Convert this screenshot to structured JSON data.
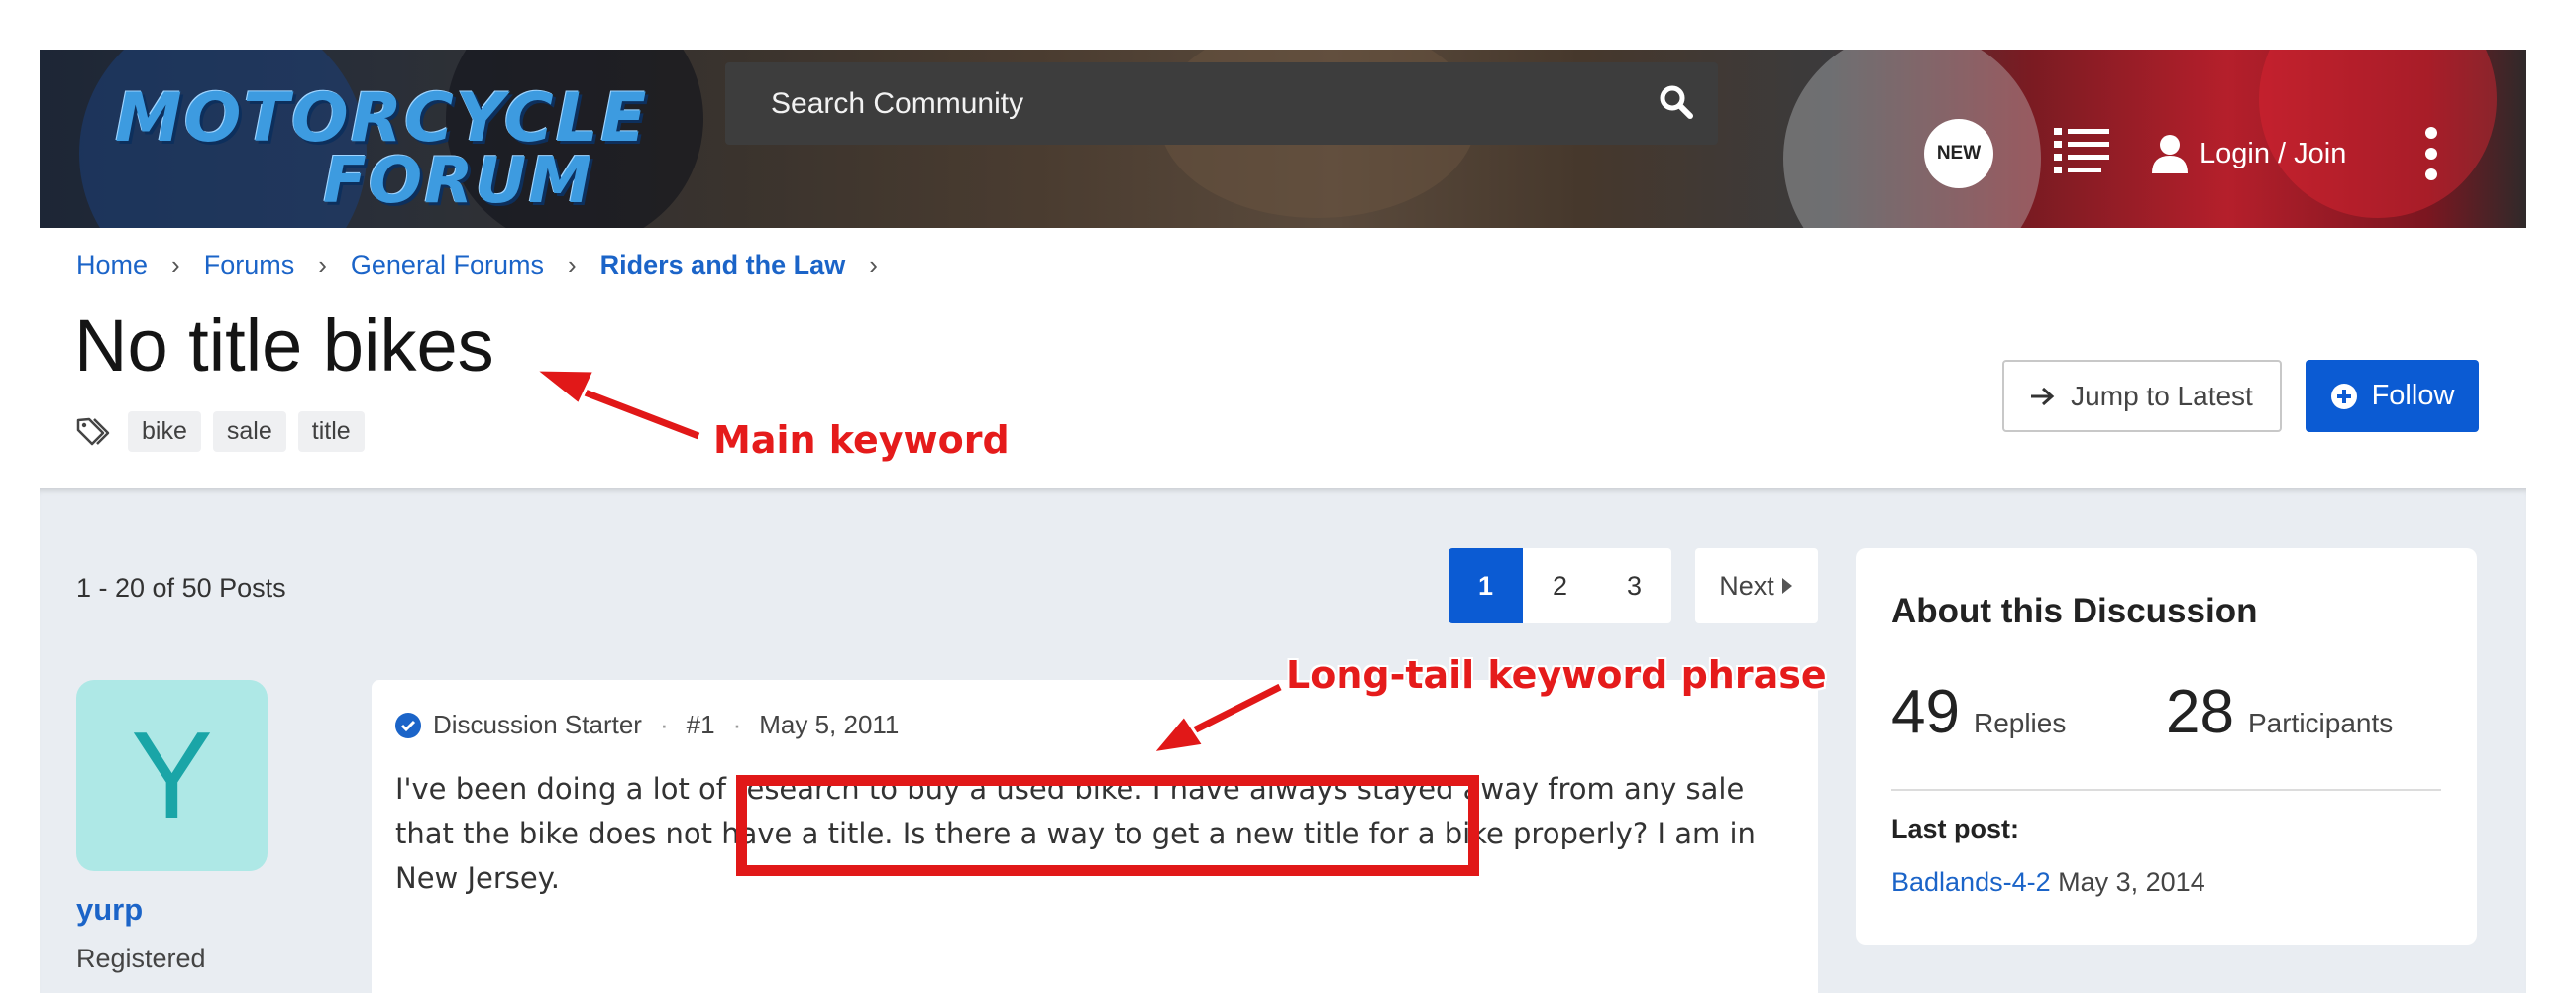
{
  "header": {
    "logo": {
      "line1": "MOTORCYCLE",
      "line2": "FORUM"
    },
    "search_placeholder": "Search Community",
    "new_badge": "NEW",
    "login_label": "Login / Join",
    "icons": [
      "search-icon",
      "list-icon",
      "user-icon",
      "kebab-menu-icon"
    ]
  },
  "breadcrumb": [
    "Home",
    "Forums",
    "General Forums",
    "Riders and the Law"
  ],
  "thread": {
    "title": "No title bikes",
    "tags": [
      "bike",
      "sale",
      "title"
    ],
    "jump_label": "Jump to Latest",
    "follow_label": "Follow"
  },
  "posts_header": {
    "count_text": "1 - 20 of 50 Posts",
    "pages": [
      "1",
      "2",
      "3"
    ],
    "active_page": "1",
    "next_label": "Next"
  },
  "post": {
    "avatar_letter": "Y",
    "username": "yurp",
    "role": "Registered",
    "starter_label": "Discussion Starter",
    "number": "#1",
    "date": "May 5, 2011",
    "body": "I've been doing a lot of research to buy a used bike. I have always stayed away from any sale that the bike does not have a title. Is there a way to get a new title for a bike properly? I am in New Jersey."
  },
  "about": {
    "title": "About this Discussion",
    "replies_num": "49",
    "replies_label": "Replies",
    "participants_num": "28",
    "participants_label": "Participants",
    "last_post_label": "Last post:",
    "last_post_user": "Badlands-4-2",
    "last_post_date": "May 3, 2014"
  },
  "annotations": {
    "main_keyword": "Main keyword",
    "long_tail": "Long-tail keyword phrase",
    "color": "#e51b1b"
  },
  "colors": {
    "accent": "#0b5bd3",
    "link": "#1b64c8",
    "avatar_bg": "#aee8e6",
    "avatar_fg": "#1aa5a7"
  }
}
